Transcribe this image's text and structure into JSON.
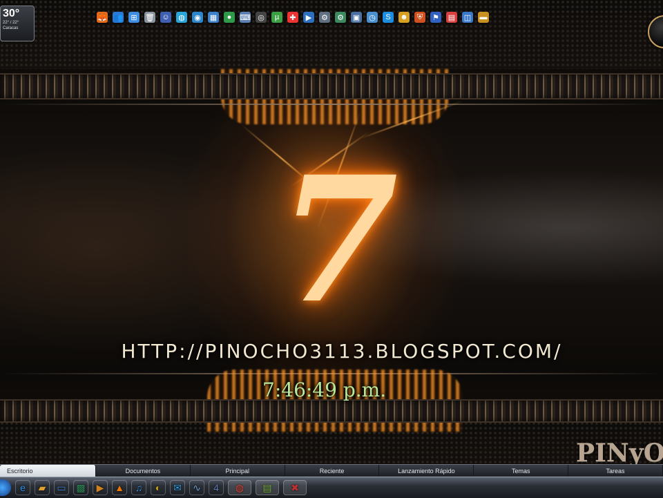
{
  "weather": {
    "temperature": "30°",
    "range": "22° / 22°",
    "city": "Caracas"
  },
  "wallpaper": {
    "logo_numeral": "7",
    "url": "HTTP://PINOCHO3113.BLOGSPOT.COM/",
    "clock": "7:46:49 p.m.",
    "brand": "PINyO"
  },
  "top_icons": [
    {
      "name": "firefox-icon",
      "glyph": "🦊",
      "color": "#e86a17"
    },
    {
      "name": "messenger-icon",
      "glyph": "👥",
      "color": "#2a78d8"
    },
    {
      "name": "windows-icon",
      "glyph": "⊞",
      "color": "#3e8de0"
    },
    {
      "name": "recycle-bin-icon",
      "glyph": "🗑",
      "color": "#8a949e"
    },
    {
      "name": "user-icon",
      "glyph": "☺",
      "color": "#3f5fb0"
    },
    {
      "name": "globe-icon",
      "glyph": "◍",
      "color": "#2aa5d8"
    },
    {
      "name": "network-icon",
      "glyph": "◉",
      "color": "#2d86c9"
    },
    {
      "name": "control-panel-icon",
      "glyph": "▦",
      "color": "#3b80c8"
    },
    {
      "name": "ccleaner-icon",
      "glyph": "●",
      "color": "#2f9a4a"
    },
    {
      "name": "keyboard-icon",
      "glyph": "⌨",
      "color": "#5b7fb0"
    },
    {
      "name": "cd-drive-icon",
      "glyph": "◎",
      "color": "#444"
    },
    {
      "name": "utorrent-icon",
      "glyph": "µ",
      "color": "#3aa042"
    },
    {
      "name": "antivirus-icon",
      "glyph": "✚",
      "color": "#e33"
    },
    {
      "name": "media-player-icon",
      "glyph": "▶",
      "color": "#2d70c0"
    },
    {
      "name": "system-icon",
      "glyph": "⚙",
      "color": "#607080"
    },
    {
      "name": "settings-icon",
      "glyph": "⚙",
      "color": "#3d8a60"
    },
    {
      "name": "computer-icon",
      "glyph": "▣",
      "color": "#4a6fa0"
    },
    {
      "name": "clock-icon",
      "glyph": "◷",
      "color": "#4a90d0"
    },
    {
      "name": "skype-icon",
      "glyph": "S",
      "color": "#1d8de0"
    },
    {
      "name": "smiley-icon",
      "glyph": "☻",
      "color": "#d8a020"
    },
    {
      "name": "shield-icon",
      "glyph": "⛨",
      "color": "#d05020"
    },
    {
      "name": "flag-icon",
      "glyph": "⚑",
      "color": "#3060c0"
    },
    {
      "name": "calendar-icon",
      "glyph": "▤",
      "color": "#d84040"
    },
    {
      "name": "device-icon",
      "glyph": "◫",
      "color": "#3a78c8"
    },
    {
      "name": "chest-icon",
      "glyph": "▬",
      "color": "#c89020"
    }
  ],
  "dock_tabs": [
    {
      "label": "Escritorio",
      "active": true
    },
    {
      "label": "Documentos"
    },
    {
      "label": "Principal"
    },
    {
      "label": "Reciente"
    },
    {
      "label": "Lanzamiento Rápido"
    },
    {
      "label": "Temas"
    },
    {
      "label": "Tareas"
    }
  ],
  "taskbar_icons": [
    {
      "name": "internet-explorer-icon",
      "glyph": "e",
      "color": "#2f8ee6"
    },
    {
      "name": "folder-icon",
      "glyph": "▰",
      "color": "#e0a030"
    },
    {
      "name": "desktop-icon",
      "glyph": "▭",
      "color": "#3c82d0"
    },
    {
      "name": "media-center-icon",
      "glyph": "▩",
      "color": "#2e8b57"
    },
    {
      "name": "video-player-icon",
      "glyph": "▶",
      "color": "#d08020"
    },
    {
      "name": "vlc-icon",
      "glyph": "▲",
      "color": "#f07800"
    },
    {
      "name": "itunes-icon",
      "glyph": "♫",
      "color": "#3a88d8"
    },
    {
      "name": "nero-icon",
      "glyph": "◐",
      "color": "#c8a010"
    },
    {
      "name": "messenger-icon",
      "glyph": "✉",
      "color": "#2d9ae0"
    },
    {
      "name": "network-tool-icon",
      "glyph": "∿",
      "color": "#6aa0d0"
    },
    {
      "name": "photoshop-icon",
      "glyph": "4",
      "color": "#5a78b0"
    },
    {
      "name": "chrome-icon",
      "glyph": "◍",
      "color": "#d94a3a",
      "pinned": true
    },
    {
      "name": "notepad-icon",
      "glyph": "▤",
      "color": "#7ab040",
      "pinned": true
    },
    {
      "name": "app-icon",
      "glyph": "✖",
      "color": "#c03030",
      "pinned": true
    }
  ]
}
